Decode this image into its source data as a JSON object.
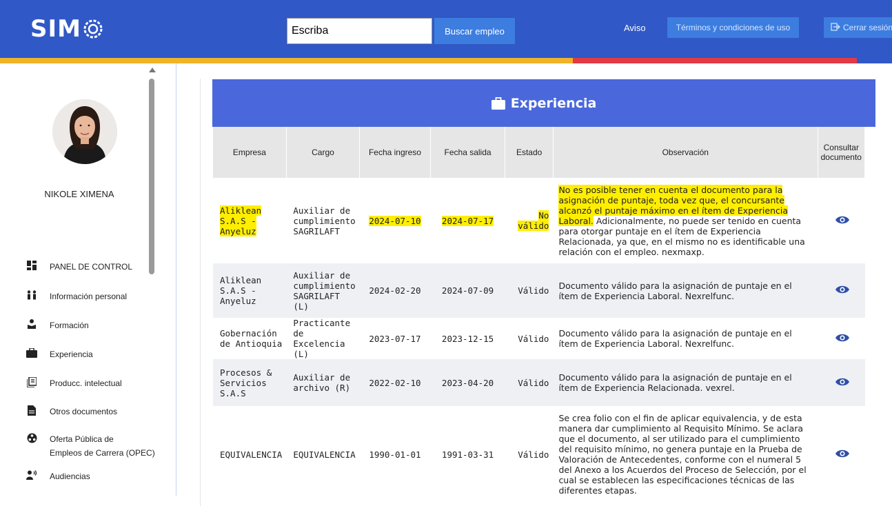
{
  "header": {
    "logo_text": "SIM",
    "search_value": "Escriba",
    "search_button": "Buscar empleo",
    "aviso": "Aviso",
    "terms_button": "Términos y condiciones de uso",
    "logout_button": "Cerrar sesión"
  },
  "colors": {
    "header_bg": "#3058c6",
    "panel_header_bg": "#4a68db",
    "highlight": "#ffee00",
    "stripe_yellow": "#f0b429",
    "stripe_red": "#e23a45"
  },
  "sidebar": {
    "user_name": "NIKOLE XIMENA",
    "items": [
      {
        "label": "PANEL DE CONTROL",
        "icon": "dashboard-icon"
      },
      {
        "label": "Información personal",
        "icon": "people-icon"
      },
      {
        "label": "Formación",
        "icon": "graduation-icon"
      },
      {
        "label": "Experiencia",
        "icon": "briefcase-icon"
      },
      {
        "label": "Producc. intelectual",
        "icon": "book-icon"
      },
      {
        "label": "Otros documentos",
        "icon": "document-icon"
      },
      {
        "label": "Oferta Pública de",
        "label2": "Empleos de Carrera (OPEC)",
        "icon": "network-icon"
      },
      {
        "label": "Audiencias",
        "icon": "speaker-icon"
      }
    ]
  },
  "panel": {
    "title": "Experiencia",
    "columns": [
      "Empresa",
      "Cargo",
      "Fecha ingreso",
      "Fecha salida",
      "Estado",
      "Observación",
      "Consultar documento"
    ],
    "rows": [
      {
        "empresa": "Aliklean S.A.S - Anyeluz",
        "cargo": "Auxiliar de cumplimiento SAGRILAFT",
        "fecha_ingreso": "2024-07-10",
        "fecha_salida": "2024-07-17",
        "estado": "No válido",
        "obs_highlight": "No es posible tener en cuenta el documento para la asignación de puntaje, toda vez que, el concursante alcanzó el puntaje máximo en el ítem de Experiencia Laboral.",
        "obs": "Adicionalmente, no puede ser tenido en cuenta para otorgar puntaje en el ítem de Experiencia Relacionada, ya que, en el mismo no es identificable una relación con el empleo. nexmaxp."
      },
      {
        "empresa": "Aliklean S.A.S - Anyeluz",
        "cargo": "Auxiliar de cumplimiento SAGRILAFT (L)",
        "fecha_ingreso": "2024-02-20",
        "fecha_salida": "2024-07-09",
        "estado": "Válido",
        "obs": "Documento válido para la asignación de puntaje en el ítem de Experiencia Laboral. Nexrelfunc."
      },
      {
        "empresa": "Gobernación de Antioquia",
        "cargo": "Practicante de Excelencia (L)",
        "fecha_ingreso": "2023-07-17",
        "fecha_salida": "2023-12-15",
        "estado": "Válido",
        "obs": "Documento válido para la asignación de puntaje en el ítem de Experiencia Laboral. Nexrelfunc."
      },
      {
        "empresa": "Procesos & Servicios S.A.S",
        "cargo": "Auxiliar de archivo (R)",
        "fecha_ingreso": "2022-02-10",
        "fecha_salida": "2023-04-20",
        "estado": "Válido",
        "obs": "Documento válido para la asignación de puntaje en el ítem de Experiencia Relacionada. vexrel."
      },
      {
        "empresa": "EQUIVALENCIA",
        "cargo": "EQUIVALENCIA",
        "fecha_ingreso": "1990-01-01",
        "fecha_salida": "1991-03-31",
        "estado": "Válido",
        "obs": "Se crea folio con el fin de aplicar equivalencia, y de esta manera dar cumplimiento al Requisito Mínimo. Se aclara que el documento, al ser utilizado para el cumplimiento del requisito mínimo, no genera puntaje en la Prueba de Valoración de Antecedentes, conforme con el numeral 5 del Anexo a los Acuerdos del Proceso de Selección, por el cual se establecen las especificaciones técnicas de las diferentes etapas."
      }
    ]
  }
}
